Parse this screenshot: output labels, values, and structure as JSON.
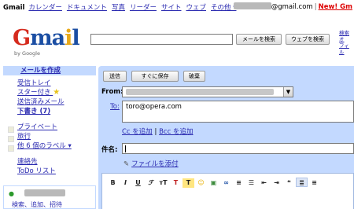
{
  "topbar": {
    "brand": "Gmail",
    "nav": [
      "カレンダー",
      "ドキュメント",
      "写真",
      "リーダー",
      "サイト",
      "ウェブ",
      "その他 ▾"
    ],
    "account_suffix": "@gmail.com",
    "new_link": "New! Gm"
  },
  "logo": {
    "by": "by Google"
  },
  "search": {
    "mail_button": "メールを検索",
    "web_button": "ウェブを検索",
    "side_links": [
      "検索オ",
      "フィル"
    ]
  },
  "sidebar": {
    "compose": "メールを作成",
    "items": [
      "受信トレイ",
      "スター付き",
      "送信済みメール",
      "下書き (7)"
    ],
    "labels": [
      "プライベート",
      "旅行",
      "他 6 個のラベル ▾"
    ],
    "links": [
      "連絡先",
      "ToDo リスト"
    ],
    "chat_actions": [
      "検索、追加、招待"
    ]
  },
  "compose": {
    "send": "送信",
    "save_now": "すぐに保存",
    "discard": "破棄",
    "from_label": "From:",
    "to_label": "To:",
    "to_value": "toro@opera.com",
    "cc_link": "Cc を追加",
    "cc_sep": " | ",
    "bcc_link": "Bcc を追加",
    "subject_label": "件名:",
    "subject_value": "",
    "attach": "ファイルを添付"
  },
  "colors": {
    "pane": "#c3d9ff",
    "link": "#2a2ab0",
    "new": "#dd0000"
  },
  "icons": [
    "star-icon",
    "paperclip-icon",
    "bold-icon",
    "italic-icon",
    "underline-icon",
    "font-icon",
    "font-size-icon",
    "text-color-icon",
    "highlight-icon",
    "emoticon-icon",
    "image-icon",
    "link-icon",
    "numbered-list-icon",
    "bullet-list-icon",
    "indent-less-icon",
    "indent-more-icon",
    "quote-icon",
    "align-left-icon",
    "align-center-icon"
  ]
}
